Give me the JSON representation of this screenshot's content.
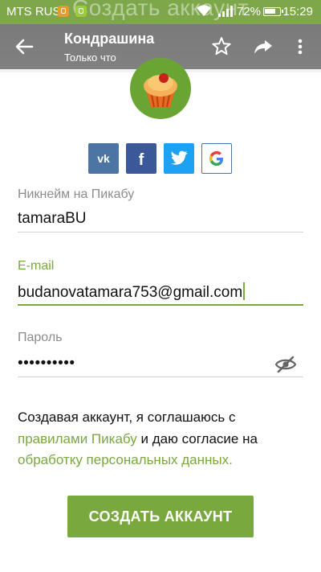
{
  "statusbar": {
    "carrier": "MTS RUS",
    "battery": "72%",
    "time": "15:29"
  },
  "background_page": {
    "title": "Создать аккаунт"
  },
  "toolbar": {
    "title": "Кондрашина",
    "subtitle": "Только что"
  },
  "social": [
    "vk",
    "facebook",
    "twitter",
    "google"
  ],
  "form": {
    "nickname": {
      "label": "Никнейм на Пикабу",
      "value": "tamaraBU"
    },
    "email": {
      "label": "E-mail",
      "value": "budanovatamara753@gmail.com"
    },
    "password": {
      "label": "Пароль",
      "value": "••••••••••"
    }
  },
  "terms": {
    "part1": "Создавая аккаунт, я соглашаюсь с",
    "link1": "правилами Пикабу",
    "part2": "и даю согласие на",
    "link2": "обработку персональных данных."
  },
  "create_button": "СОЗДАТЬ АККАУНТ",
  "colors": {
    "accent": "#79a83f",
    "vk": "#4c75a3",
    "facebook": "#3b5998",
    "twitter": "#1da1f2"
  }
}
